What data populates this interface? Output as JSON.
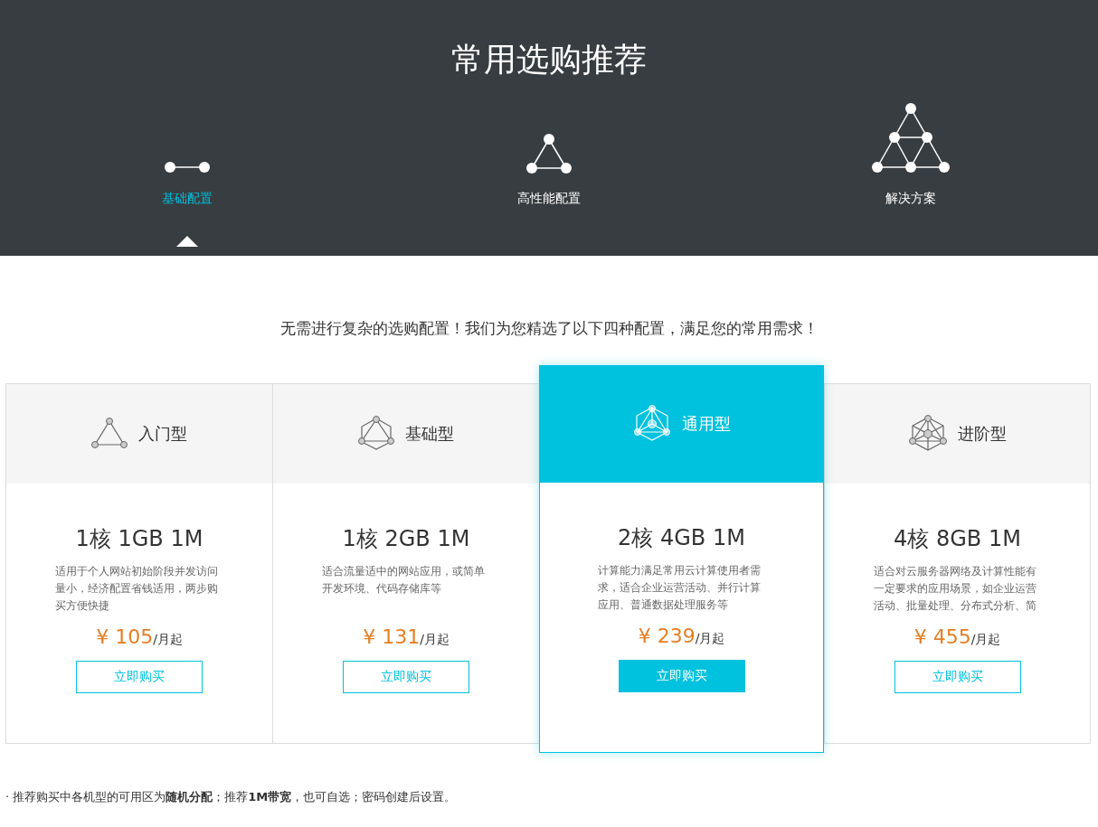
{
  "header": {
    "title": "常用选购推荐",
    "tabs": [
      {
        "label": "基础配置",
        "kind": "pair",
        "selected": true
      },
      {
        "label": "高性能配置",
        "kind": "triangle",
        "selected": false
      },
      {
        "label": "解决方案",
        "kind": "pyramid",
        "selected": false
      }
    ]
  },
  "intro": "无需进行复杂的选购配置！我们为您精选了以下四种配置，满足您的常用需求！",
  "plans": [
    {
      "name": "入门型",
      "kind": "triangle",
      "featured": false,
      "spec": "1核 1GB 1M",
      "description": "适用于个人网站初始阶段并发访问量小，经济配置省钱适用，两步购买方便快捷",
      "price": "¥ 105",
      "unit": "/月起",
      "button": "立即购买"
    },
    {
      "name": "基础型",
      "kind": "hexagon",
      "featured": false,
      "spec": "1核 2GB 1M",
      "description": "适合流量适中的网站应用，或简单开发环境、代码存储库等",
      "price": "¥ 131",
      "unit": "/月起",
      "button": "立即购买"
    },
    {
      "name": "通用型",
      "kind": "prism",
      "featured": true,
      "spec": "2核 4GB 1M",
      "description": "计算能力满足常用云计算使用者需求，适合企业运营活动、并行计算应用、普通数据处理服务等",
      "price": "¥ 239",
      "unit": "/月起",
      "button": "立即购买"
    },
    {
      "name": "进阶型",
      "kind": "crystal",
      "featured": false,
      "spec": "4核 8GB 1M",
      "description": "适合对云服务器网络及计算性能有一定要求的应用场景，如企业运营活动、批量处理、分布式分析、简",
      "price": "¥ 455",
      "unit": "/月起",
      "button": "立即购买"
    }
  ],
  "footnote": "· 推荐购买中各机型的可用区为**随机分配**；推荐**1M带宽**，也可自选；密码创建后设置。"
}
